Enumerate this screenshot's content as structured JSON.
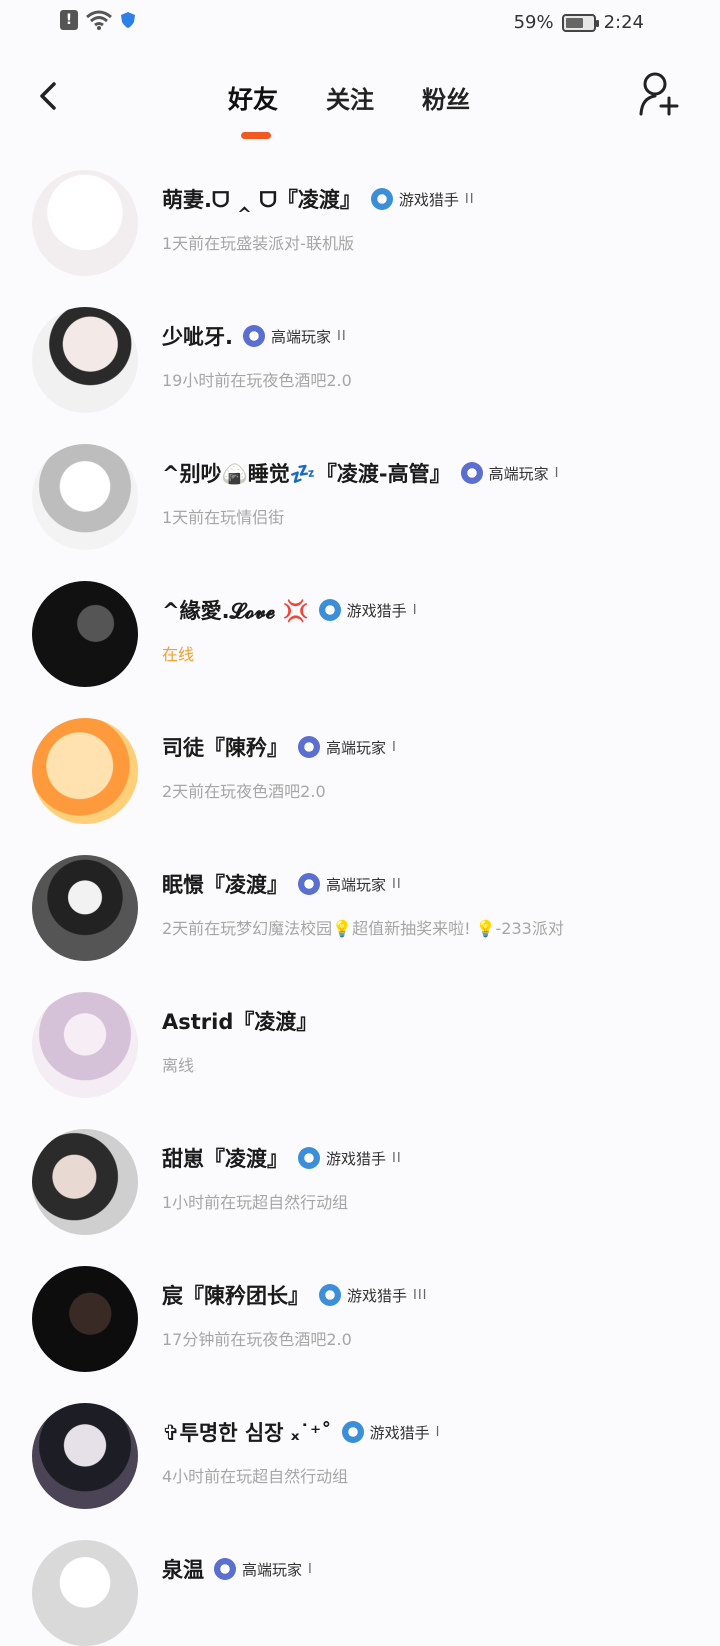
{
  "status_bar": {
    "alert_symbol": "!",
    "battery_percent": "59%",
    "battery_level": 0.59,
    "time": "2:24"
  },
  "tabs": [
    {
      "label": "好友",
      "active": true
    },
    {
      "label": "关注",
      "active": false
    },
    {
      "label": "粉丝",
      "active": false
    }
  ],
  "accent_color": "#f05a22",
  "friends": [
    {
      "name": "萌妻.ᗜ ‸ ᗜ『凌渡』",
      "badge": "游戏猎手",
      "level": "II",
      "status": "1天前在玩盛装派对-联机版",
      "online": false
    },
    {
      "name": "少呲牙.",
      "badge": "高端玩家",
      "level": "II",
      "status": "19小时前在玩夜色酒吧2.0",
      "online": false
    },
    {
      "name": "^别吵🍙睡觉💤『凌渡-高管』",
      "badge": "高端玩家",
      "level": "I",
      "status": "1天前在玩情侣街",
      "online": false
    },
    {
      "name": "^緣愛.𝓛𝓸𝓿𝓮 💢",
      "badge": "游戏猎手",
      "level": "I",
      "status": "在线",
      "online": true
    },
    {
      "name": "司徒『陳矜』",
      "badge": "高端玩家",
      "level": "I",
      "status": "2天前在玩夜色酒吧2.0",
      "online": false
    },
    {
      "name": "眠憬『凌渡』",
      "badge": "高端玩家",
      "level": "II",
      "status": "2天前在玩梦幻魔法校园💡超值新抽奖来啦! 💡-233派对",
      "online": false
    },
    {
      "name": "Astrid『凌渡』",
      "badge": "",
      "level": "",
      "status": "离线",
      "online": false
    },
    {
      "name": "甜崽『凌渡』",
      "badge": "游戏猎手",
      "level": "II",
      "status": "1小时前在玩超自然行动组",
      "online": false
    },
    {
      "name": "宸『陳矜团长』",
      "badge": "游戏猎手",
      "level": "III",
      "status": "17分钟前在玩夜色酒吧2.0",
      "online": false
    },
    {
      "name": "✞투명한 심장 ₓ˙⁺˚",
      "badge": "游戏猎手",
      "level": "I",
      "status": "4小时前在玩超自然行动组",
      "online": false
    },
    {
      "name": "泉温",
      "badge": "高端玩家",
      "level": "I",
      "status": "",
      "online": false
    }
  ]
}
